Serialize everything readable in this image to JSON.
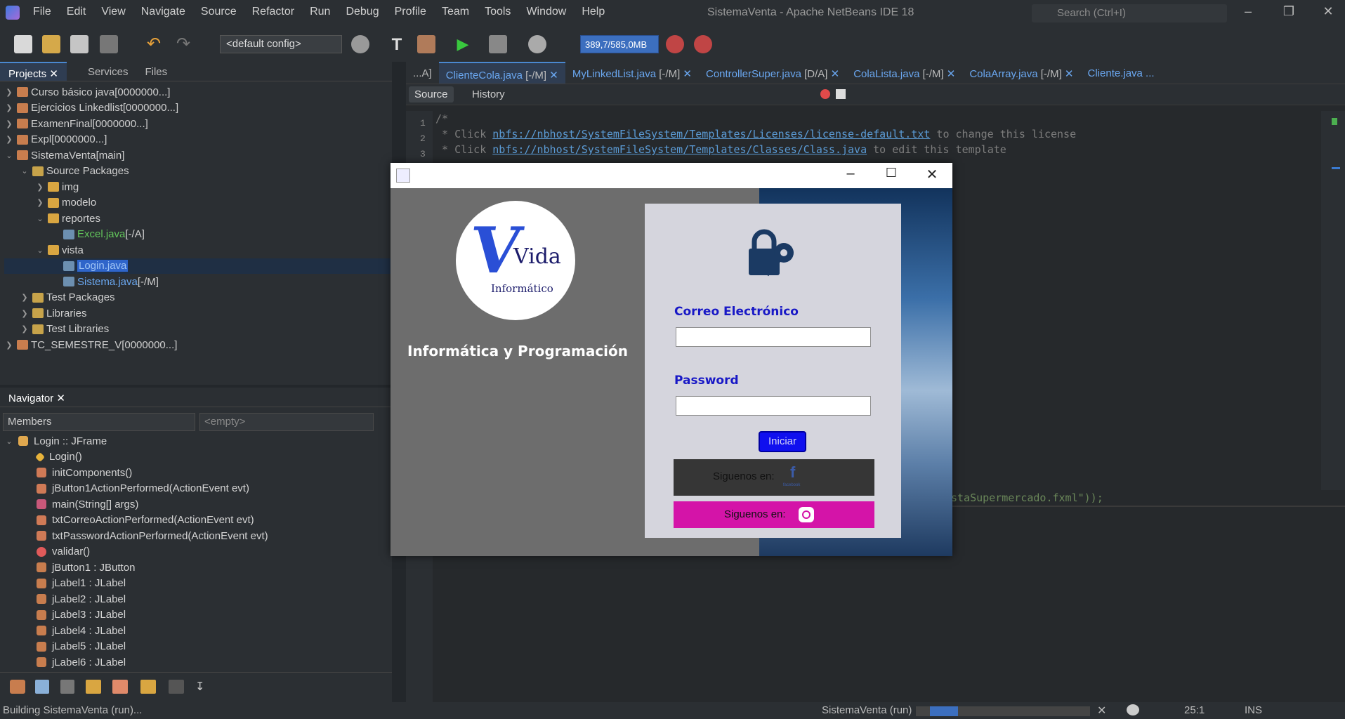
{
  "menu": [
    "File",
    "Edit",
    "View",
    "Navigate",
    "Source",
    "Refactor",
    "Run",
    "Debug",
    "Profile",
    "Team",
    "Tools",
    "Window",
    "Help"
  ],
  "window_title": "SistemaVenta - Apache NetBeans IDE 18",
  "search_placeholder": "Search (Ctrl+I)",
  "toolbar": {
    "config": "<default config>",
    "memory": "389,7/585,0MB"
  },
  "projects_tabs": [
    "Projects",
    "Services",
    "Files"
  ],
  "project_tree": [
    {
      "label": "Curso básico java",
      "suffix": " [0000000...]"
    },
    {
      "label": "Ejercicios Linkedlist",
      "suffix": " [0000000...]"
    },
    {
      "label": "ExamenFinal",
      "suffix": " [0000000...]"
    },
    {
      "label": "Expl",
      "suffix": " [0000000...]"
    },
    {
      "label": "SistemaVenta",
      "suffix": " [main]"
    },
    {
      "label": "Source Packages",
      "suffix": ""
    },
    {
      "label": "img",
      "suffix": ""
    },
    {
      "label": "modelo",
      "suffix": ""
    },
    {
      "label": "reportes",
      "suffix": ""
    },
    {
      "label": "Excel.java",
      "suffix": " [-/A]"
    },
    {
      "label": "vista",
      "suffix": ""
    },
    {
      "label": "Login.java",
      "suffix": ""
    },
    {
      "label": "Sistema.java",
      "suffix": " [-/M]"
    },
    {
      "label": "Test Packages",
      "suffix": ""
    },
    {
      "label": "Libraries",
      "suffix": ""
    },
    {
      "label": "Test Libraries",
      "suffix": ""
    },
    {
      "label": "TC_SEMESTRE_V",
      "suffix": " [0000000...]"
    }
  ],
  "navigator": {
    "title": "Navigator",
    "members": "Members",
    "empty": "<empty>",
    "items": [
      {
        "label": "Login :: JFrame"
      },
      {
        "label": "Login()"
      },
      {
        "label": "initComponents()"
      },
      {
        "label": "jButton1ActionPerformed(ActionEvent evt)"
      },
      {
        "label": "main(String[] args)"
      },
      {
        "label": "txtCorreoActionPerformed(ActionEvent evt)"
      },
      {
        "label": "txtPasswordActionPerformed(ActionEvent evt)"
      },
      {
        "label": "validar()"
      },
      {
        "label": "jButton1 : JButton"
      },
      {
        "label": "jLabel1 : JLabel"
      },
      {
        "label": "jLabel2 : JLabel"
      },
      {
        "label": "jLabel3 : JLabel"
      },
      {
        "label": "jLabel4 : JLabel"
      },
      {
        "label": "jLabel5 : JLabel"
      },
      {
        "label": "jLabel6 : JLabel"
      }
    ]
  },
  "editor_tabs": [
    {
      "name": "...A]",
      "status": ""
    },
    {
      "name": "ClienteCola.java",
      "status": " [-/M]"
    },
    {
      "name": "MyLinkedList.java",
      "status": " [-/M]"
    },
    {
      "name": "ControllerSuper.java",
      "status": " [D/A]"
    },
    {
      "name": "ColaLista.java",
      "status": " [-/M]"
    },
    {
      "name": "ColaArray.java",
      "status": " [-/M]"
    },
    {
      "name": "Cliente.java ...",
      "status": ""
    }
  ],
  "editor_modes": {
    "source": "Source",
    "history": "History"
  },
  "code": {
    "line1": "/*",
    "line2_pre": " * Click ",
    "line2_link": "nbfs://nbhost/SystemFileSystem/Templates/Licenses/license-default.txt",
    "line2_post": " to change this license",
    "line3_pre": " * Click ",
    "line3_link": "nbfs://nbhost/SystemFileSystem/Templates/Classes/Class.java",
    "line3_post": " to edit this template",
    "partial": "staSupermercado.fxml\"));"
  },
  "login": {
    "brand_big": "Vida",
    "brand_small": "Informático",
    "tagline": "Informática y Programación",
    "email_label": "Correo Electrónico",
    "password_label": "Password",
    "button": "Iniciar",
    "follow_fb": "Siguenos en:",
    "fb_small": "facebook",
    "follow_ig": "Siguenos en:"
  },
  "status": {
    "left": "Building SistemaVenta (run)...",
    "run": "SistemaVenta (run)",
    "pos": "25:1",
    "mode": "INS"
  }
}
